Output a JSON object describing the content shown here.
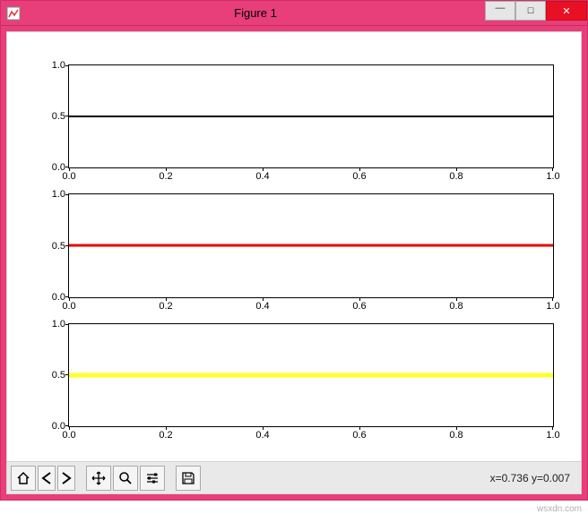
{
  "window": {
    "title": "Figure 1",
    "minimize_label": "–",
    "maximize_label": "☐",
    "close_label": "✕"
  },
  "toolbar": {
    "home": "home-icon",
    "back": "back-icon",
    "forward": "forward-icon",
    "pan": "move-icon",
    "zoom": "zoom-icon",
    "configure": "sliders-icon",
    "save": "save-icon",
    "coord_text": "x=0.736 y=0.007"
  },
  "axes": {
    "yticks": [
      "0.0",
      "0.5",
      "1.0"
    ],
    "xticks": [
      "0.0",
      "0.2",
      "0.4",
      "0.6",
      "0.8",
      "1.0"
    ]
  },
  "watermark": "wsxdn.com",
  "chart_data": [
    {
      "type": "line",
      "title": "",
      "xlabel": "",
      "ylabel": "",
      "xlim": [
        0.0,
        1.0
      ],
      "ylim": [
        0.0,
        1.0
      ],
      "series": [
        {
          "name": "black",
          "color": "#000000",
          "linewidth": 1.5,
          "x": [
            0.0,
            1.0
          ],
          "y": [
            0.5,
            0.5
          ]
        }
      ]
    },
    {
      "type": "line",
      "title": "",
      "xlabel": "",
      "ylabel": "",
      "xlim": [
        0.0,
        1.0
      ],
      "ylim": [
        0.0,
        1.0
      ],
      "series": [
        {
          "name": "red",
          "color": "#e80000",
          "linewidth": 2.5,
          "x": [
            0.0,
            1.0
          ],
          "y": [
            0.5,
            0.5
          ]
        }
      ]
    },
    {
      "type": "line",
      "title": "",
      "xlabel": "",
      "ylabel": "",
      "xlim": [
        0.0,
        1.0
      ],
      "ylim": [
        0.0,
        1.0
      ],
      "series": [
        {
          "name": "yellow",
          "color": "#ffff2b",
          "linewidth": 4.5,
          "x": [
            0.0,
            1.0
          ],
          "y": [
            0.5,
            0.5
          ]
        }
      ]
    }
  ]
}
